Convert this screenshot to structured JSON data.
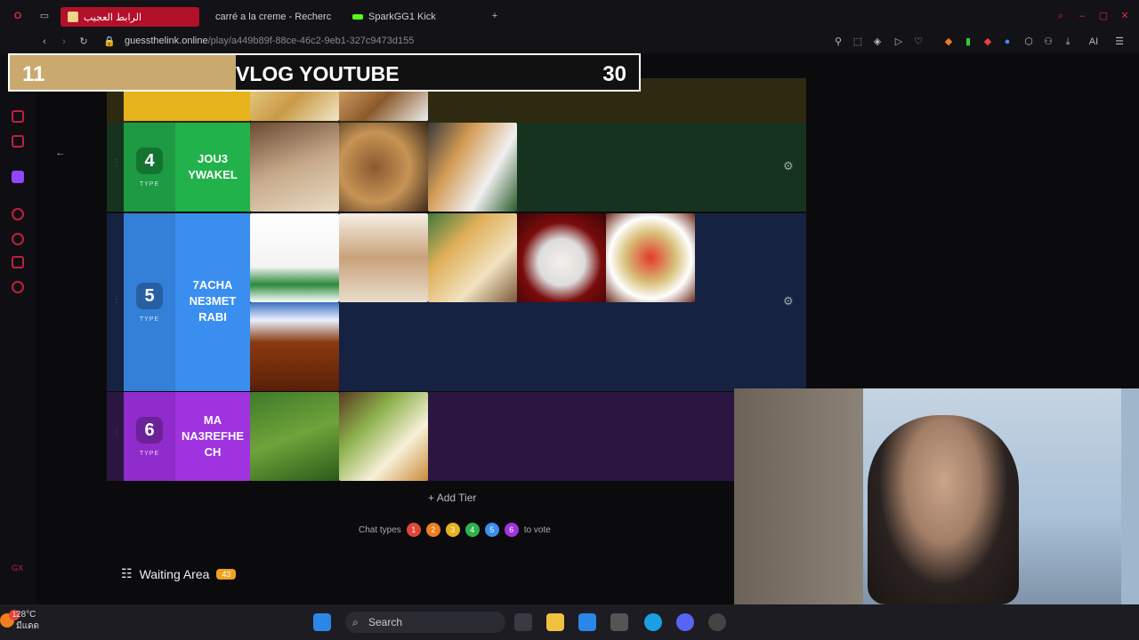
{
  "browser": {
    "tabs": [
      {
        "label": "الرابط العجيب",
        "active": true
      },
      {
        "label": "carré a la creme - Recherc"
      },
      {
        "label": "SparkGG1 Kick"
      }
    ],
    "new_tab": "+",
    "url_host": "guessthelink.online",
    "url_path": "/play/a449b89f-88ce-46c2-9eb1-327c9473d155"
  },
  "banner": {
    "left": "11",
    "title": "VLOG YOUTUBE",
    "right": "30",
    "progress_fraction": 0.36
  },
  "tiers": [
    {
      "number": "4",
      "type": "TYPE",
      "name": "JOU3 YWAKEL",
      "color": "#22b24c"
    },
    {
      "number": "5",
      "type": "TYPE",
      "name": "7ACHA NE3MET RABI",
      "color": "#3a8ef0"
    },
    {
      "number": "6",
      "type": "TYPE",
      "name": "MA NA3REFHE CH",
      "color": "#a033e0"
    }
  ],
  "add_tier": "Add Tier",
  "chat": {
    "prefix": "Chat types",
    "numbers": [
      "1",
      "2",
      "3",
      "4",
      "5",
      "6"
    ],
    "suffix": "to vote",
    "colors": [
      "#e2453b",
      "#f07e1e",
      "#e6b31c",
      "#2fb24c",
      "#3a8ef0",
      "#a033e0"
    ]
  },
  "waiting": {
    "label": "Waiting Area",
    "count": "43"
  },
  "taskbar": {
    "temp": "28°C",
    "weather": "มีแดด",
    "notif": "1",
    "search": "Search"
  }
}
